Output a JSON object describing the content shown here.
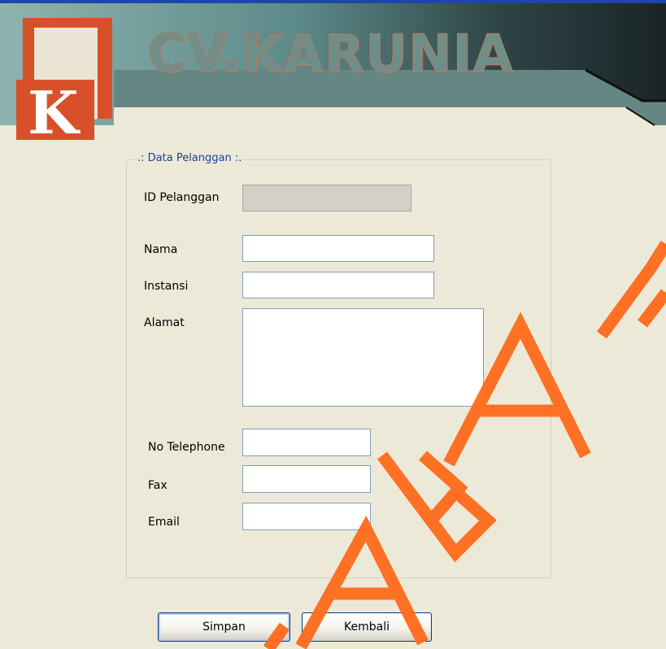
{
  "header": {
    "brand_name": "CV.KARUNIA",
    "logo_letter": "K",
    "colors": {
      "logo": "#D8502A",
      "banner_dark": "#1F2D2F",
      "banner_teal": "#5E8C8B"
    }
  },
  "form": {
    "group_title": ".: Data Pelanggan :.",
    "fields": {
      "id_pelanggan": {
        "label": "ID Pelanggan",
        "value": ""
      },
      "nama": {
        "label": "Nama",
        "value": ""
      },
      "instansi": {
        "label": "Instansi",
        "value": ""
      },
      "alamat": {
        "label": "Alamat",
        "value": ""
      },
      "no_telephone": {
        "label": "No Telephone",
        "value": ""
      },
      "fax": {
        "label": "Fax",
        "value": ""
      },
      "email": {
        "label": "Email",
        "value": ""
      }
    }
  },
  "buttons": {
    "simpan": "Simpan",
    "kembali": "Kembali"
  },
  "watermark": {
    "color": "#FF6A1A"
  }
}
